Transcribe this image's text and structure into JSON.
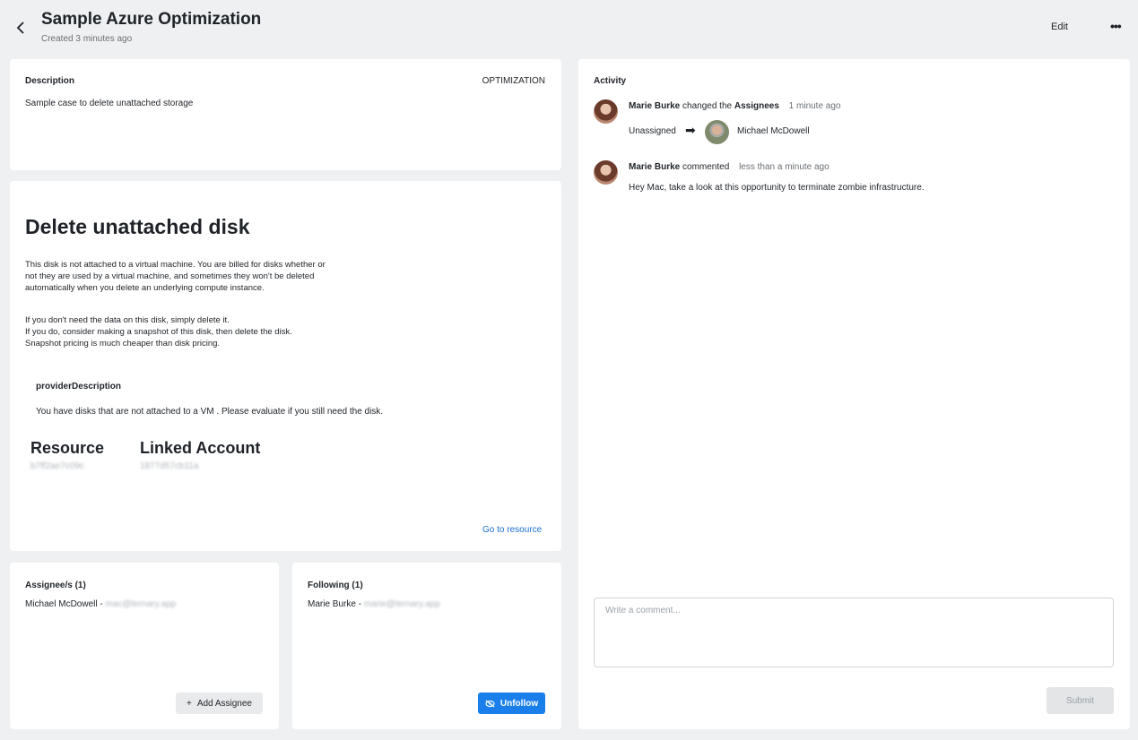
{
  "header": {
    "title": "Sample Azure Optimization",
    "subtitle": "Created 3 minutes ago",
    "edit_label": "Edit",
    "more_label": "•••"
  },
  "description": {
    "heading": "Description",
    "category": "OPTIMIZATION",
    "text": "Sample case to delete unattached storage"
  },
  "detail": {
    "title": "Delete unattached disk",
    "para1": "This disk is not attached to a virtual machine. You are billed for disks whether or not they are used by a virtual machine, and sometimes they won't be deleted automatically when you delete an underlying compute instance.",
    "para2_line1": "If you don't need the data on this disk, simply delete it.",
    "para2_line2": "If you do, consider making a snapshot of this disk, then delete the disk.",
    "para2_line3": "Snapshot pricing is much cheaper than disk pricing.",
    "provider_heading": "providerDescription",
    "provider_text": "You have disks that are not attached to a VM . Please evaluate if you still need the disk.",
    "resource_label": "Resource",
    "resource_value": "b7ff2ae7c09c",
    "account_label": "Linked Account",
    "account_value": "1877d57cb11a",
    "go_link": "Go to resource"
  },
  "assignees": {
    "heading": "Assignee/s (1)",
    "name": "Michael McDowell",
    "separator": " - ",
    "email": "mac@ternary.app",
    "add_icon": "+",
    "add_label": "Add Assignee"
  },
  "following": {
    "heading": "Following (1)",
    "name": "Marie Burke",
    "separator": " - ",
    "email": "marie@ternary.app",
    "unfollow_label": "Unfollow"
  },
  "activity": {
    "heading": "Activity",
    "entries": [
      {
        "user": "Marie Burke",
        "action": " changed the ",
        "target": "Assignees",
        "time": "1 minute ago",
        "from": "Unassigned",
        "arrow": "➡",
        "to": "Michael McDowell"
      },
      {
        "user": "Marie Burke",
        "action": " commented",
        "time": "less than a minute ago",
        "comment": "Hey Mac, take a look at this opportunity to terminate zombie infrastructure."
      }
    ],
    "comment_placeholder": "Write a comment...",
    "submit_label": "Submit"
  }
}
